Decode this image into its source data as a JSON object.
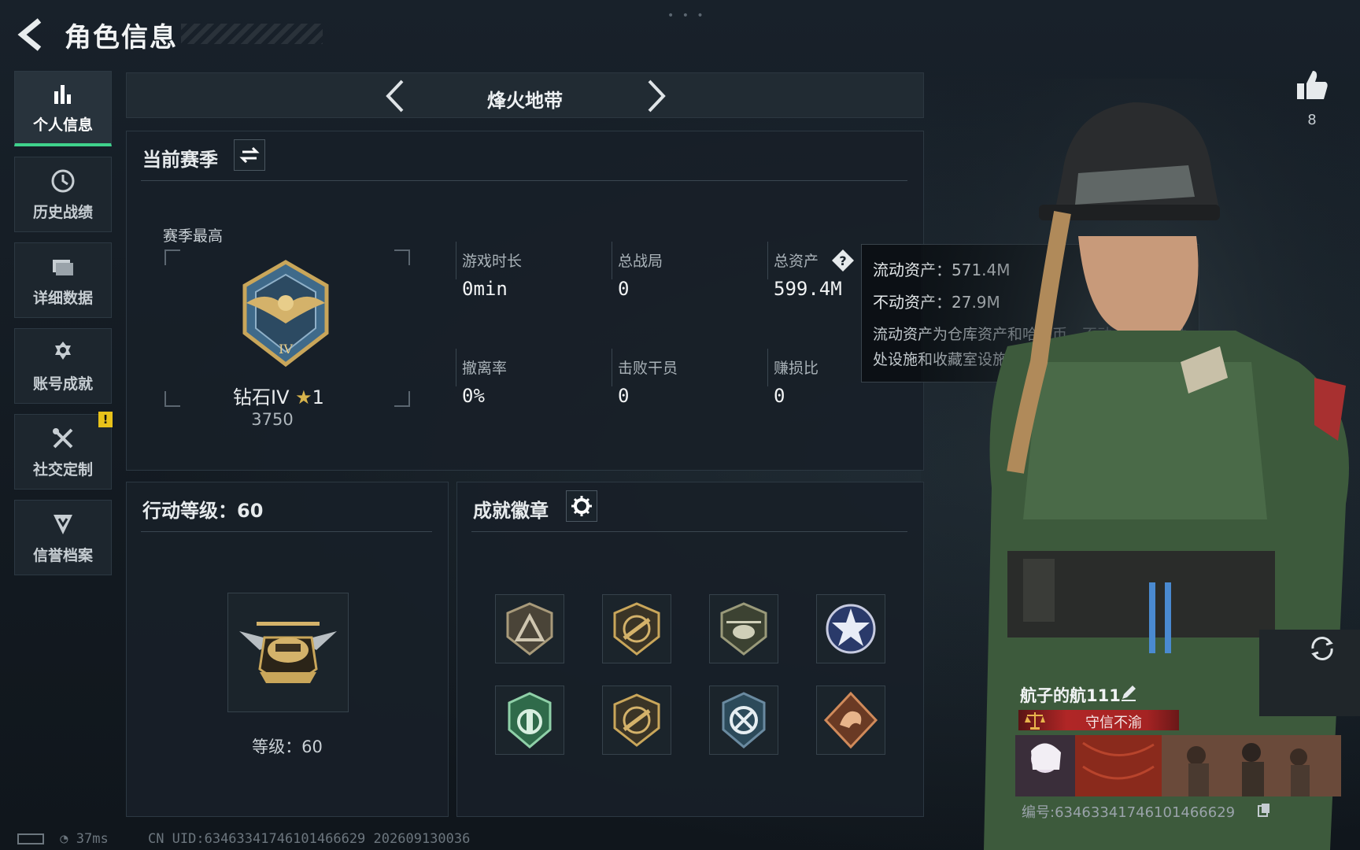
{
  "header": {
    "title": "角色信息"
  },
  "sidebar": {
    "items": [
      {
        "label": "个人信息",
        "icon": "bar-chart-icon"
      },
      {
        "label": "历史战绩",
        "icon": "clock-icon"
      },
      {
        "label": "详细数据",
        "icon": "folder-icon"
      },
      {
        "label": "账号成就",
        "icon": "medal-icon"
      },
      {
        "label": "社交定制",
        "icon": "tools-icon"
      },
      {
        "label": "信誉档案",
        "icon": "shield-down-icon"
      }
    ],
    "alert_badge": "!"
  },
  "mode": {
    "title": "烽火地带"
  },
  "season": {
    "title": "当前赛季",
    "best_label": "赛季最高",
    "rank_name": "钻石IV",
    "rank_stars": "1",
    "rank_points": "3750",
    "stats": [
      {
        "label": "游戏时长",
        "value": "0min"
      },
      {
        "label": "总战局",
        "value": "0"
      },
      {
        "label": "总资产",
        "value": "599.4M"
      },
      {
        "label": "撤离率",
        "value": "0%"
      },
      {
        "label": "击败干员",
        "value": "0"
      },
      {
        "label": "赚损比",
        "value": "0"
      }
    ]
  },
  "tooltip": {
    "liquid": "流动资产：571.4M",
    "fixed": "不动资产：27.9M",
    "desc": "流动资产为仓库资产和哈夫币，不动资产为特勤处设施和收藏室设施"
  },
  "action_level": {
    "title": "行动等级：60",
    "level_text": "等级：60"
  },
  "badges": {
    "title": "成就徽章",
    "items": [
      "triangle-shield-badge",
      "rifle-shield-badge",
      "helicopter-badge",
      "star-globe-badge",
      "green-emblem-badge",
      "rifle-shield-badge-2",
      "arrows-globe-badge",
      "dragon-badge"
    ]
  },
  "player": {
    "likes": "8",
    "name": "航子的航111",
    "honor": "守信不渝",
    "uid_label": "编号:634633417461014666​29"
  },
  "footer": {
    "ping": "37ms",
    "uid": "CN UID:634633417461014666​29 202609130036"
  },
  "colors": {
    "accent": "#3fd28c",
    "alert": "#e8c21a",
    "honor": "#b02626"
  }
}
